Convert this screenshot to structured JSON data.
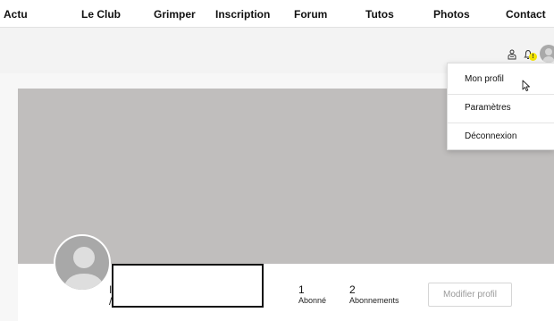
{
  "nav": {
    "items": [
      {
        "label": "Actu"
      },
      {
        "label": "Le Club"
      },
      {
        "label": "Grimper"
      },
      {
        "label": "Inscription"
      },
      {
        "label": "Forum"
      },
      {
        "label": "Tutos"
      },
      {
        "label": "Photos"
      },
      {
        "label": "Contact"
      }
    ]
  },
  "header": {
    "notification_badge": "!",
    "icons": [
      "people-icon",
      "bell-icon",
      "avatar"
    ]
  },
  "dropdown": {
    "items": [
      {
        "label": "Mon profil"
      },
      {
        "label": "Paramètres"
      },
      {
        "label": "Déconnexion"
      }
    ]
  },
  "profile": {
    "name_fragment_top": "I",
    "name_fragment_bottom": "/",
    "followers_count": "1",
    "followers_label": "Abonné",
    "following_count": "2",
    "following_label": "Abonnements",
    "edit_button": "Modifier profil"
  },
  "colors": {
    "cover": "#c0bebd",
    "badge": "#f3e500",
    "appbar": "#f3f3f3"
  }
}
